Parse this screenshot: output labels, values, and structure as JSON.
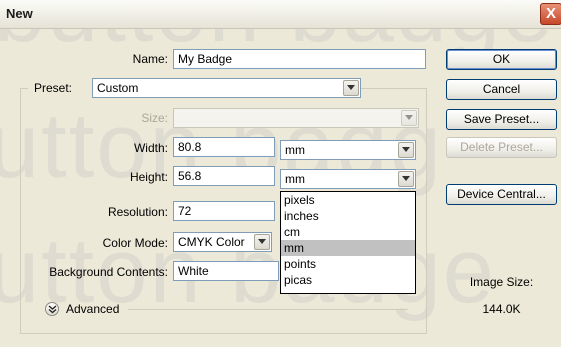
{
  "window": {
    "title": "New",
    "close_glyph": "X"
  },
  "watermark": {
    "line1": "button badge",
    "line2": "utton badg",
    "line3": "utton badge"
  },
  "form": {
    "name_label": "Name:",
    "name_value": "My Badge",
    "preset_label": "Preset:",
    "preset_value": "Custom",
    "size_label": "Size:",
    "size_value": "",
    "width_label": "Width:",
    "width_value": "80.8",
    "width_unit": "mm",
    "height_label": "Height:",
    "height_value": "56.8",
    "height_unit": "mm",
    "resolution_label": "Resolution:",
    "resolution_value": "72",
    "color_mode_label": "Color Mode:",
    "color_mode_value": "CMYK Color",
    "background_label": "Background Contents:",
    "background_value": "White",
    "advanced_label": "Advanced"
  },
  "unit_options": [
    "pixels",
    "inches",
    "cm",
    "mm",
    "points",
    "picas"
  ],
  "unit_selected": "mm",
  "buttons": {
    "ok": "OK",
    "cancel": "Cancel",
    "save_preset": "Save Preset...",
    "delete_preset": "Delete Preset...",
    "device_central": "Device Central..."
  },
  "image_size": {
    "label": "Image Size:",
    "value": "144.0K"
  },
  "icons": {
    "dropdown": "chevron-down-icon",
    "advanced": "double-chevron-down-icon",
    "close": "close-icon"
  }
}
